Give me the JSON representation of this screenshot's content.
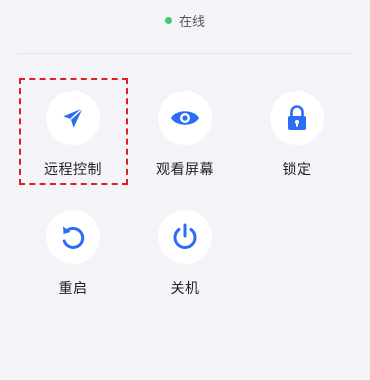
{
  "status": {
    "text": "在线",
    "dot_color": "#3ecf6b"
  },
  "accent_color": "#2a6ef5",
  "actions": [
    {
      "id": "remote-control",
      "label": "远程控制",
      "icon": "paper-plane-icon"
    },
    {
      "id": "view-screen",
      "label": "观看屏幕",
      "icon": "eye-icon"
    },
    {
      "id": "lock",
      "label": "锁定",
      "icon": "lock-icon"
    },
    {
      "id": "restart",
      "label": "重启",
      "icon": "restart-icon"
    },
    {
      "id": "shutdown",
      "label": "关机",
      "icon": "power-icon"
    }
  ]
}
